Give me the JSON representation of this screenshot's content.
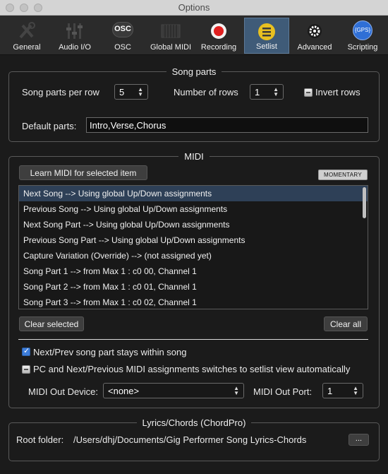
{
  "window": {
    "title": "Options"
  },
  "toolbar": {
    "items": [
      {
        "label": "General",
        "icon": "tools-icon"
      },
      {
        "label": "Audio I/O",
        "icon": "mixer-faders-icon"
      },
      {
        "label": "OSC",
        "icon": "osc-icon"
      },
      {
        "label": "Global MIDI",
        "icon": "keyboard-icon"
      },
      {
        "label": "Recording",
        "icon": "record-icon"
      },
      {
        "label": "Setlist",
        "icon": "setlist-icon"
      },
      {
        "label": "Advanced",
        "icon": "gear-icon"
      },
      {
        "label": "Scripting",
        "icon": "gps-icon"
      }
    ],
    "osc_icon_text": "OSC",
    "gps_icon_text": "{GPS}",
    "active": "Setlist"
  },
  "song_parts": {
    "title": "Song parts",
    "per_row_label": "Song parts per row",
    "per_row_value": "5",
    "rows_label": "Number of rows",
    "rows_value": "1",
    "invert_label": "Invert rows",
    "default_label": "Default parts:",
    "default_value": "Intro,Verse,Chorus"
  },
  "midi": {
    "title": "MIDI",
    "learn_button": "Learn MIDI for selected item",
    "momentary_button": "MOMENTARY",
    "items": [
      "Next Song --> Using global Up/Down assignments",
      "Previous Song --> Using global Up/Down assignments",
      "Next Song Part --> Using global Up/Down assignments",
      "Previous Song Part --> Using global Up/Down assignments",
      "Capture Variation (Override) --> (not assigned yet)",
      "Song Part 1 --> from Max 1 : c0 00, Channel 1",
      "Song Part 2 --> from Max 1 : c0 01, Channel 1",
      "Song Part 3 --> from Max 1 : c0 02, Channel 1"
    ],
    "clear_selected": "Clear selected",
    "clear_all": "Clear all",
    "stay_within_song": "Next/Prev song part stays within song",
    "pc_switches": "PC and Next/Previous MIDI assignments switches to setlist view automatically",
    "out_device_label": "MIDI Out Device:",
    "out_device_value": "<none>",
    "out_port_label": "MIDI Out Port:",
    "out_port_value": "1"
  },
  "lyrics": {
    "title": "Lyrics/Chords (ChordPro)",
    "root_label": "Root folder:",
    "root_value": "/Users/dhj/Documents/Gig Performer Song Lyrics-Chords",
    "browse_button": "..."
  },
  "colors": {
    "accent": "#3f5b78",
    "record": "#e02020",
    "setlist_icon": "#e8c020"
  }
}
